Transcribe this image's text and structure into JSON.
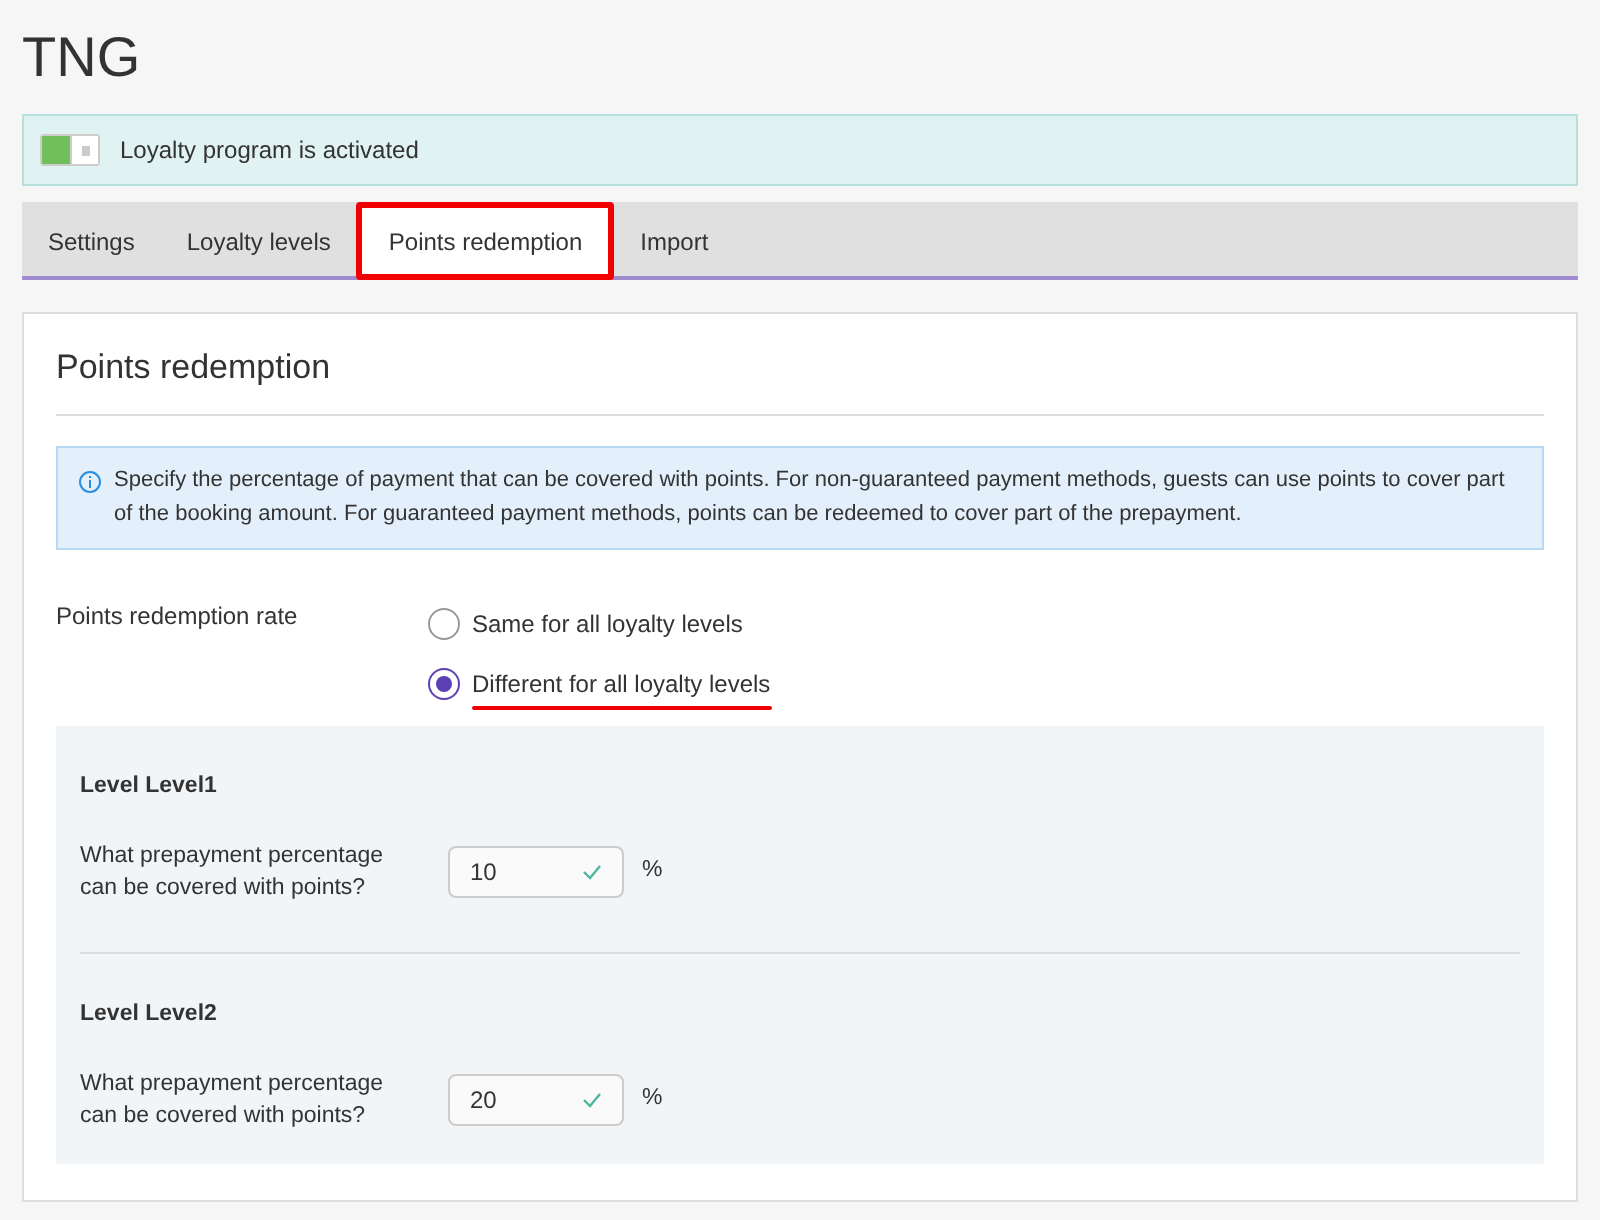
{
  "page_title": "TNG",
  "program_banner": {
    "on": true,
    "text": "Loyalty program is activated"
  },
  "tabs": [
    {
      "label": "Settings",
      "selected": false
    },
    {
      "label": "Loyalty levels",
      "selected": false
    },
    {
      "label": "Points redemption",
      "selected": true
    },
    {
      "label": "Import",
      "selected": false
    }
  ],
  "section": {
    "title": "Points redemption",
    "info": "Specify the percentage of payment that can be covered with points. For non-guaranteed payment methods, guests can use points to cover part of the booking amount. For guaranteed payment methods, points can be redeemed to cover part of the prepayment.",
    "rate_label": "Points redemption rate",
    "rate_options": [
      {
        "label": "Same for all loyalty levels",
        "selected": false
      },
      {
        "label": "Different for all loyalty levels",
        "selected": true
      }
    ],
    "levels": [
      {
        "title": "Level Level1",
        "question": "What prepayment percentage can be covered with points?",
        "value": "10",
        "valid": true,
        "unit": "%"
      },
      {
        "title": "Level Level2",
        "question": "What prepayment percentage can be covered with points?",
        "value": "20",
        "valid": true,
        "unit": "%"
      }
    ]
  }
}
